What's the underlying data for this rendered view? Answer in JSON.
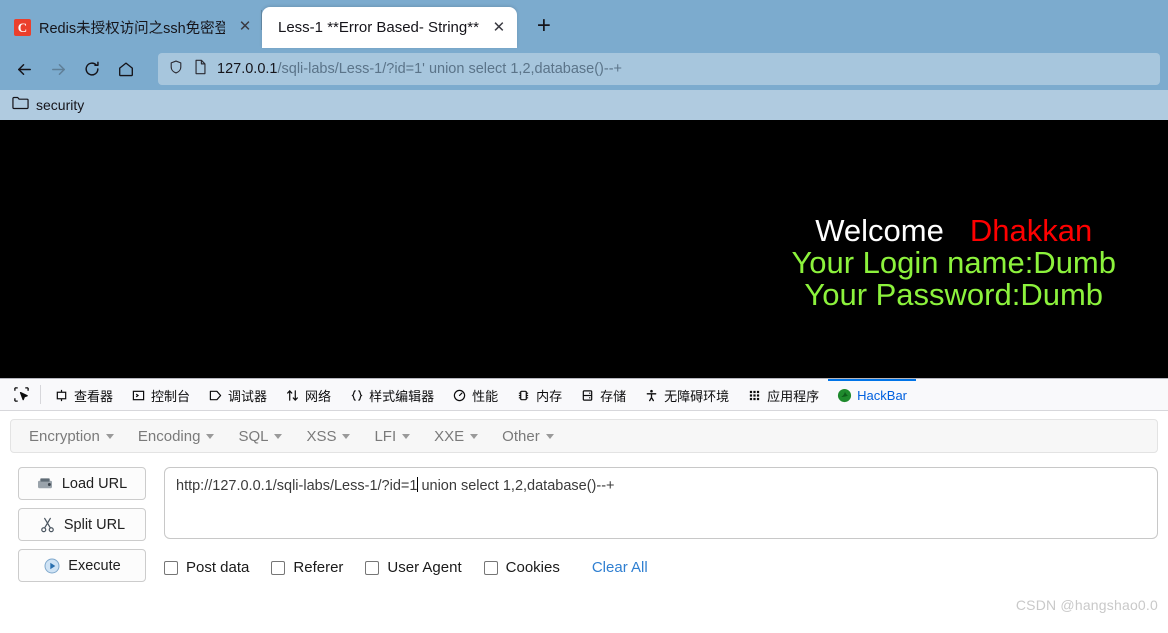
{
  "browser": {
    "tabs": [
      {
        "title": "Redis未授权访问之ssh免密登录",
        "favicon": "csdn-c-icon",
        "active": false,
        "close_label": "✕"
      },
      {
        "title": "Less-1 **Error Based- String**",
        "favicon": "",
        "active": true,
        "close_label": "✕"
      }
    ],
    "new_tab_label": "+",
    "nav": {
      "back_label": "←",
      "forward_label": "→",
      "reload_label": "⟳",
      "home_label": "⌂"
    },
    "url": {
      "host": "127.0.0.1",
      "path": "/sqli-labs/Less-1/?id=1' union select 1,2,database()--+",
      "shield_icon": "shield-icon",
      "page-icon": "page-icon"
    },
    "bookmarks": [
      {
        "label": "security",
        "icon": "folder-icon"
      }
    ]
  },
  "page": {
    "welcome": "Welcome",
    "dhakkan": "Dhakkan",
    "login_line": "Your Login name:Dumb",
    "password_line": "Your Password:Dumb",
    "colors": {
      "background": "#000000",
      "welcome": "#ffffff",
      "dhakkan": "#ff0000",
      "green": "#8cf23c"
    }
  },
  "devtools": {
    "picker_icon": "element-picker-icon",
    "tabs": [
      {
        "label": "查看器",
        "icon": "inspector-icon",
        "active": false
      },
      {
        "label": "控制台",
        "icon": "console-icon",
        "active": false
      },
      {
        "label": "调试器",
        "icon": "debugger-icon",
        "active": false
      },
      {
        "label": "网络",
        "icon": "network-icon",
        "active": false
      },
      {
        "label": "样式编辑器",
        "icon": "style-editor-icon",
        "active": false
      },
      {
        "label": "性能",
        "icon": "performance-icon",
        "active": false
      },
      {
        "label": "内存",
        "icon": "memory-icon",
        "active": false
      },
      {
        "label": "存储",
        "icon": "storage-icon",
        "active": false
      },
      {
        "label": "无障碍环境",
        "icon": "accessibility-icon",
        "active": false
      },
      {
        "label": "应用程序",
        "icon": "application-icon",
        "active": false
      },
      {
        "label": "HackBar",
        "icon": "hackbar-icon",
        "active": true
      }
    ],
    "active_tab_color": "#0060df",
    "active_tab_border": "#0074e8"
  },
  "hackbar": {
    "menus": [
      {
        "label": "Encryption"
      },
      {
        "label": "Encoding"
      },
      {
        "label": "SQL"
      },
      {
        "label": "XSS"
      },
      {
        "label": "LFI"
      },
      {
        "label": "XXE"
      },
      {
        "label": "Other"
      }
    ],
    "buttons": [
      {
        "label": "Load URL",
        "icon": "load-url-icon"
      },
      {
        "label": "Split URL",
        "icon": "scissors-icon"
      },
      {
        "label": "Execute",
        "icon": "play-icon"
      }
    ],
    "url_field": {
      "value_before_caret": "http://127.0.0.1/sqli-labs/Less-1/?id=1",
      "value_after_caret": " union select 1,2,database()--+"
    },
    "checkboxes": [
      {
        "label": "Post data",
        "checked": false
      },
      {
        "label": "Referer",
        "checked": false
      },
      {
        "label": "User Agent",
        "checked": false
      },
      {
        "label": "Cookies",
        "checked": false
      }
    ],
    "clear_all_label": "Clear All",
    "clear_all_color": "#2f7fd1"
  },
  "watermark": "CSDN @hangshao0.0"
}
